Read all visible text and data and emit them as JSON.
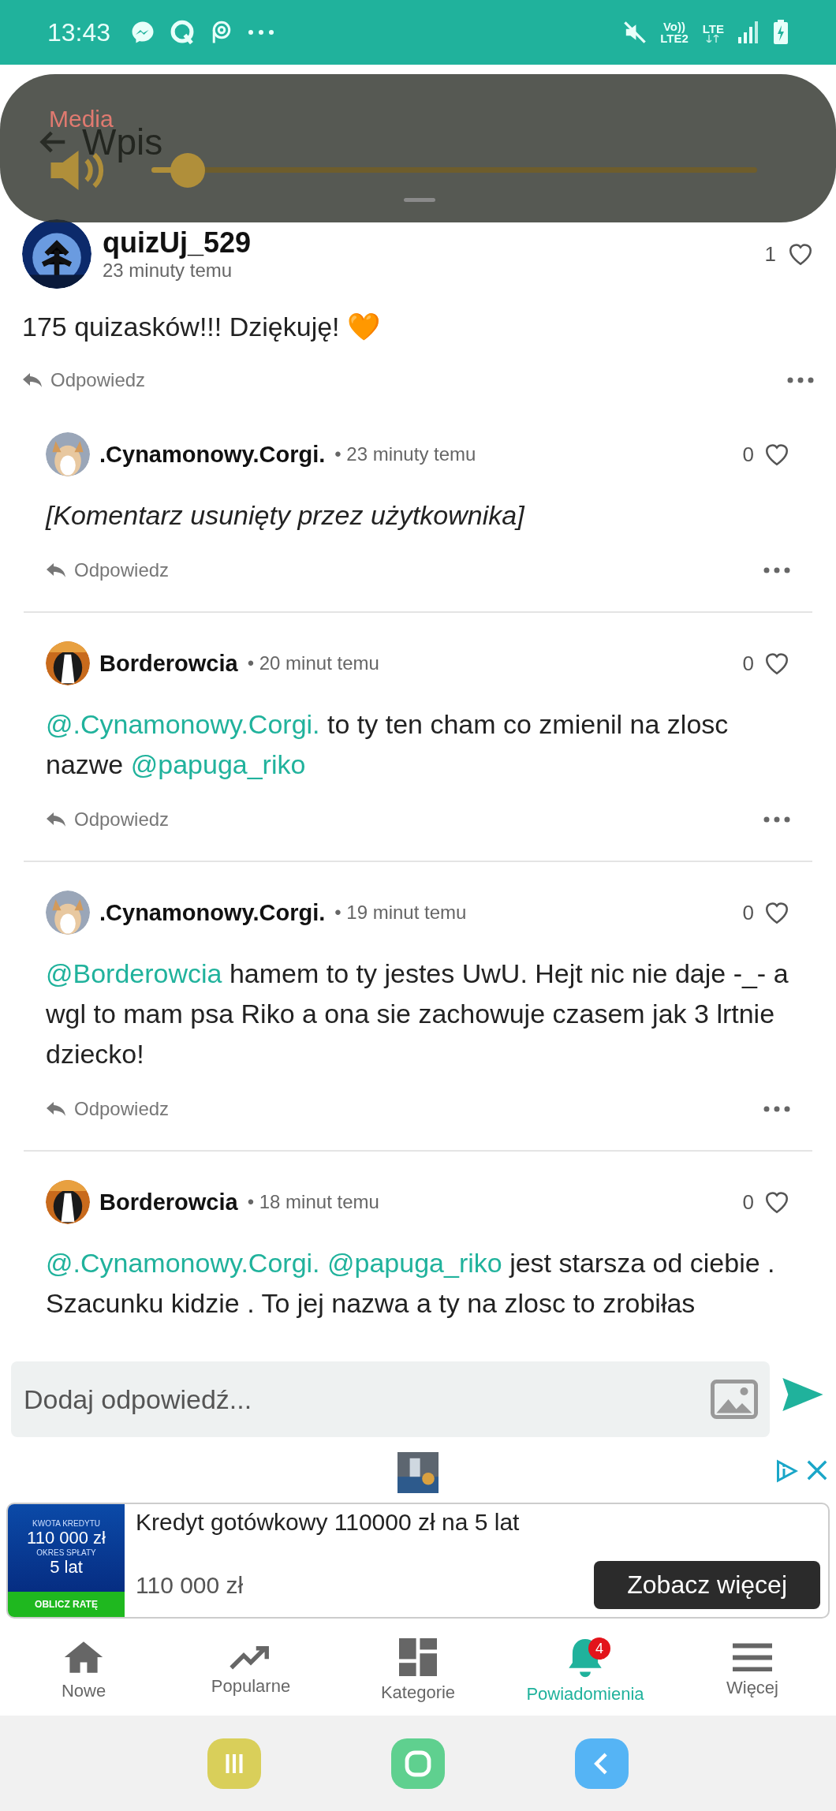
{
  "status_bar": {
    "time": "13:43",
    "network_labels": [
      "Vo))",
      "LTE2",
      "LTE"
    ]
  },
  "header": {
    "title": "Wpis"
  },
  "media_overlay": {
    "label": "Media",
    "level": 0.06
  },
  "post": {
    "author": "quizUj_529",
    "time": "23 minuty temu",
    "likes": "1",
    "text": "175 quizasków!!! Dziękuję! 🧡",
    "reply": "Odpowiedz"
  },
  "comments": [
    {
      "author": ".Cynamonowy.Corgi.",
      "time": "• 23 minuty temu",
      "likes": "0",
      "deleted": true,
      "body": [
        {
          "kind": "plain",
          "text": "[Komentarz usunięty przez użytkownika]"
        }
      ],
      "reply": "Odpowiedz"
    },
    {
      "author": "Borderowcia",
      "time": "• 20 minut temu",
      "likes": "0",
      "deleted": false,
      "body": [
        {
          "kind": "mention",
          "text": "@.Cynamonowy.Corgi."
        },
        {
          "kind": "plain",
          "text": " to ty ten cham co zmienil na zlosc nazwe "
        },
        {
          "kind": "mention",
          "text": "@papuga_riko"
        }
      ],
      "reply": "Odpowiedz"
    },
    {
      "author": ".Cynamonowy.Corgi.",
      "time": "• 19 minut temu",
      "likes": "0",
      "deleted": false,
      "body": [
        {
          "kind": "mention",
          "text": "@Borderowcia"
        },
        {
          "kind": "plain",
          "text": " hamem to ty jestes UwU. Hejt nic nie daje -_- a wgl to mam psa Riko a ona sie zachowuje czasem jak 3 lrtnie dziecko!"
        }
      ],
      "reply": "Odpowiedz"
    },
    {
      "author": "Borderowcia",
      "time": "• 18 minut temu",
      "likes": "0",
      "deleted": false,
      "body": [
        {
          "kind": "mention",
          "text": "@.Cynamonowy.Corgi."
        },
        {
          "kind": "mention",
          "text": "@papuga_riko"
        },
        {
          "kind": "plain",
          "text": " jest starsza od ciebie . Szacunku kidzie . To jej nazwa a ty na zlosc to zrobiłas"
        }
      ]
    }
  ],
  "reply_input": {
    "placeholder": "Dodaj odpowiedź..."
  },
  "ad": {
    "panel": [
      "KWOTA KREDYTU",
      "110 000 zł",
      "OKRES SPŁATY",
      "5 lat"
    ],
    "panel_button": "OBLICZ RATĘ",
    "headline": "Kredyt gotówkowy 110000 zł na 5 lat",
    "price": "110 000 zł",
    "button": "Zobacz więcej"
  },
  "bottom_nav": [
    {
      "label": "Nowe",
      "selected": false
    },
    {
      "label": "Popularne",
      "selected": false
    },
    {
      "label": "Kategorie",
      "selected": false
    },
    {
      "label": "Powiadomienia",
      "selected": true,
      "badge": "4"
    },
    {
      "label": "Więcej",
      "selected": false
    }
  ]
}
